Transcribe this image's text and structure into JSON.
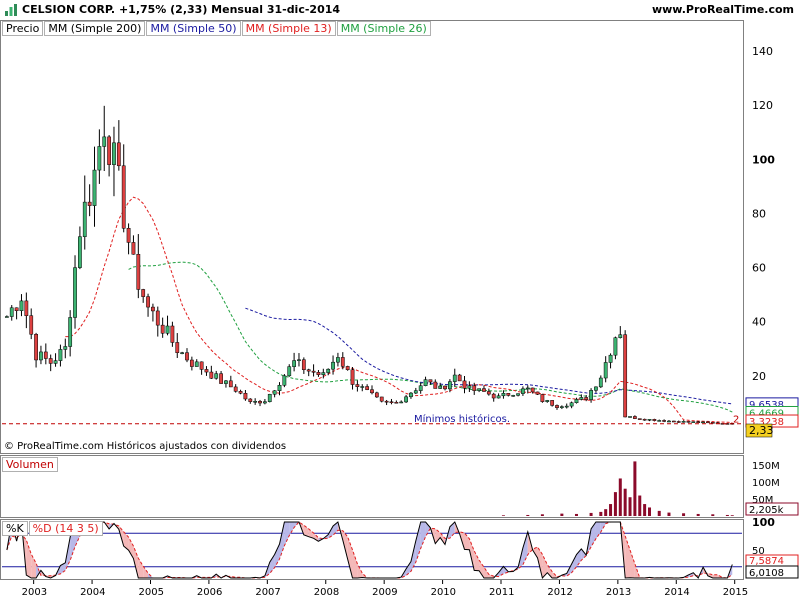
{
  "header": {
    "title": "CELSION CORP.   +1,75% (2,33)   Mensual   31-dic-2014",
    "site": "www.ProRealTime.com"
  },
  "legends": {
    "price": [
      "Precio",
      "MM (Simple 200)",
      "MM (Simple 50)",
      "MM (Simple 13)",
      "MM (Simple 26)"
    ],
    "volume": [
      "Volumen"
    ],
    "stoch": [
      "%K",
      "%D (14 3 5)"
    ]
  },
  "footer_note": "© ProRealTime.com  Históricos ajustados con dividendos",
  "annotation": "Mínimos históricos.",
  "colors": {
    "up": "#3cb371",
    "down": "#dc4040",
    "ma200": "#000000",
    "ma50": "#1a1aa0",
    "ma13": "#e02020",
    "ma26": "#20a040",
    "support": "#c00000",
    "stoch_k": "#000000",
    "stoch_d": "#e02020",
    "fill_up": "#b8b8e8",
    "fill_down": "#f4b8b8"
  },
  "chart_data": [
    {
      "type": "candlestick",
      "title": "CELSION CORP.",
      "frequency": "Mensual",
      "x_range": [
        "2002-06",
        "2015-02"
      ],
      "ylim": [
        0,
        150
      ],
      "yticks": [
        20,
        40,
        60,
        80,
        100,
        120,
        140
      ],
      "xticks": [
        "2003",
        "2004",
        "2005",
        "2006",
        "2007",
        "2008",
        "2009",
        "2010",
        "2011",
        "2012",
        "2013",
        "2014",
        "2015"
      ],
      "last_price": "2,33",
      "series_labels": [
        "9,6538",
        "6,4669",
        "3,3238"
      ],
      "reference_line": {
        "value": 2.33,
        "label": "2"
      },
      "close_points": [
        [
          "2002-07",
          42
        ],
        [
          "2002-10",
          50
        ],
        [
          "2003-01",
          28
        ],
        [
          "2003-04",
          25
        ],
        [
          "2003-07",
          30
        ],
        [
          "2003-10",
          75
        ],
        [
          "2004-01",
          95
        ],
        [
          "2004-03",
          115
        ],
        [
          "2004-06",
          90
        ],
        [
          "2004-09",
          60
        ],
        [
          "2004-12",
          45
        ],
        [
          "2005-03",
          38
        ],
        [
          "2005-06",
          30
        ],
        [
          "2005-09",
          25
        ],
        [
          "2005-12",
          22
        ],
        [
          "2006-03",
          18
        ],
        [
          "2006-06",
          15
        ],
        [
          "2006-09",
          10
        ],
        [
          "2006-12",
          11
        ],
        [
          "2007-03",
          18
        ],
        [
          "2007-06",
          25
        ],
        [
          "2007-09",
          22
        ],
        [
          "2007-12",
          20
        ],
        [
          "2008-03",
          28
        ],
        [
          "2008-06",
          18
        ],
        [
          "2008-09",
          14
        ],
        [
          "2008-12",
          10
        ],
        [
          "2009-03",
          10
        ],
        [
          "2009-06",
          14
        ],
        [
          "2009-09",
          18
        ],
        [
          "2009-12",
          15
        ],
        [
          "2010-03",
          20
        ],
        [
          "2010-06",
          15
        ],
        [
          "2010-09",
          14
        ],
        [
          "2010-12",
          12
        ],
        [
          "2011-03",
          14
        ],
        [
          "2011-06",
          15
        ],
        [
          "2011-09",
          11
        ],
        [
          "2011-12",
          9
        ],
        [
          "2012-03",
          10
        ],
        [
          "2012-06",
          12
        ],
        [
          "2012-09",
          20
        ],
        [
          "2012-12",
          35
        ],
        [
          "2013-01",
          37
        ],
        [
          "2013-02",
          5
        ],
        [
          "2013-06",
          4
        ],
        [
          "2013-12",
          3.2
        ],
        [
          "2014-06",
          2.8
        ],
        [
          "2014-12",
          2.33
        ]
      ]
    },
    {
      "type": "bar",
      "title": "Volumen",
      "yticks": [
        "50M",
        "100M",
        "150M"
      ],
      "last_value": "2,205k",
      "values_M": [
        [
          "2011-01",
          2
        ],
        [
          "2011-06",
          3
        ],
        [
          "2011-09",
          5
        ],
        [
          "2012-01",
          7
        ],
        [
          "2012-04",
          6
        ],
        [
          "2012-07",
          9
        ],
        [
          "2012-09",
          12
        ],
        [
          "2012-10",
          20
        ],
        [
          "2012-11",
          35
        ],
        [
          "2012-12",
          70
        ],
        [
          "2013-01",
          110
        ],
        [
          "2013-02",
          80
        ],
        [
          "2013-03",
          55
        ],
        [
          "2013-04",
          160
        ],
        [
          "2013-05",
          60
        ],
        [
          "2013-06",
          35
        ],
        [
          "2013-07",
          25
        ],
        [
          "2013-09",
          15
        ],
        [
          "2013-11",
          10
        ],
        [
          "2014-02",
          8
        ],
        [
          "2014-05",
          6
        ],
        [
          "2014-08",
          5
        ],
        [
          "2014-11",
          3
        ],
        [
          "2014-12",
          2.2
        ]
      ]
    },
    {
      "type": "line",
      "title": "%D (14 3 5)",
      "ylim": [
        0,
        100
      ],
      "yticks": [
        50,
        100
      ],
      "reference_lines": [
        20,
        80
      ],
      "last_values": [
        "7,5874",
        "6,0108"
      ]
    }
  ]
}
